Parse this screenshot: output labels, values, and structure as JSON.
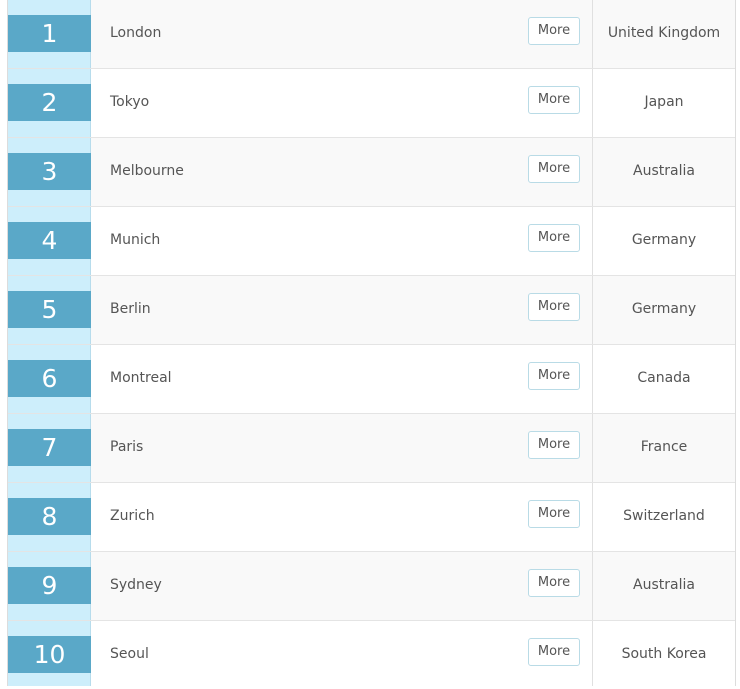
{
  "rows": [
    {
      "rank": "1",
      "city": "London",
      "more_label": "More",
      "country": "United Kingdom"
    },
    {
      "rank": "2",
      "city": "Tokyo",
      "more_label": "More",
      "country": "Japan"
    },
    {
      "rank": "3",
      "city": "Melbourne",
      "more_label": "More",
      "country": "Australia"
    },
    {
      "rank": "4",
      "city": "Munich",
      "more_label": "More",
      "country": "Germany"
    },
    {
      "rank": "5",
      "city": "Berlin",
      "more_label": "More",
      "country": "Germany"
    },
    {
      "rank": "6",
      "city": "Montreal",
      "more_label": "More",
      "country": "Canada"
    },
    {
      "rank": "7",
      "city": "Paris",
      "more_label": "More",
      "country": "France"
    },
    {
      "rank": "8",
      "city": "Zurich",
      "more_label": "More",
      "country": "Switzerland"
    },
    {
      "rank": "9",
      "city": "Sydney",
      "more_label": "More",
      "country": "Australia"
    },
    {
      "rank": "10",
      "city": "Seoul",
      "more_label": "More",
      "country": "South Korea"
    }
  ],
  "colors": {
    "rank_badge": "#5aa8c8",
    "rank_column": "#cdeefb",
    "row_odd": "#f9f9f9",
    "row_even": "#ffffff"
  }
}
